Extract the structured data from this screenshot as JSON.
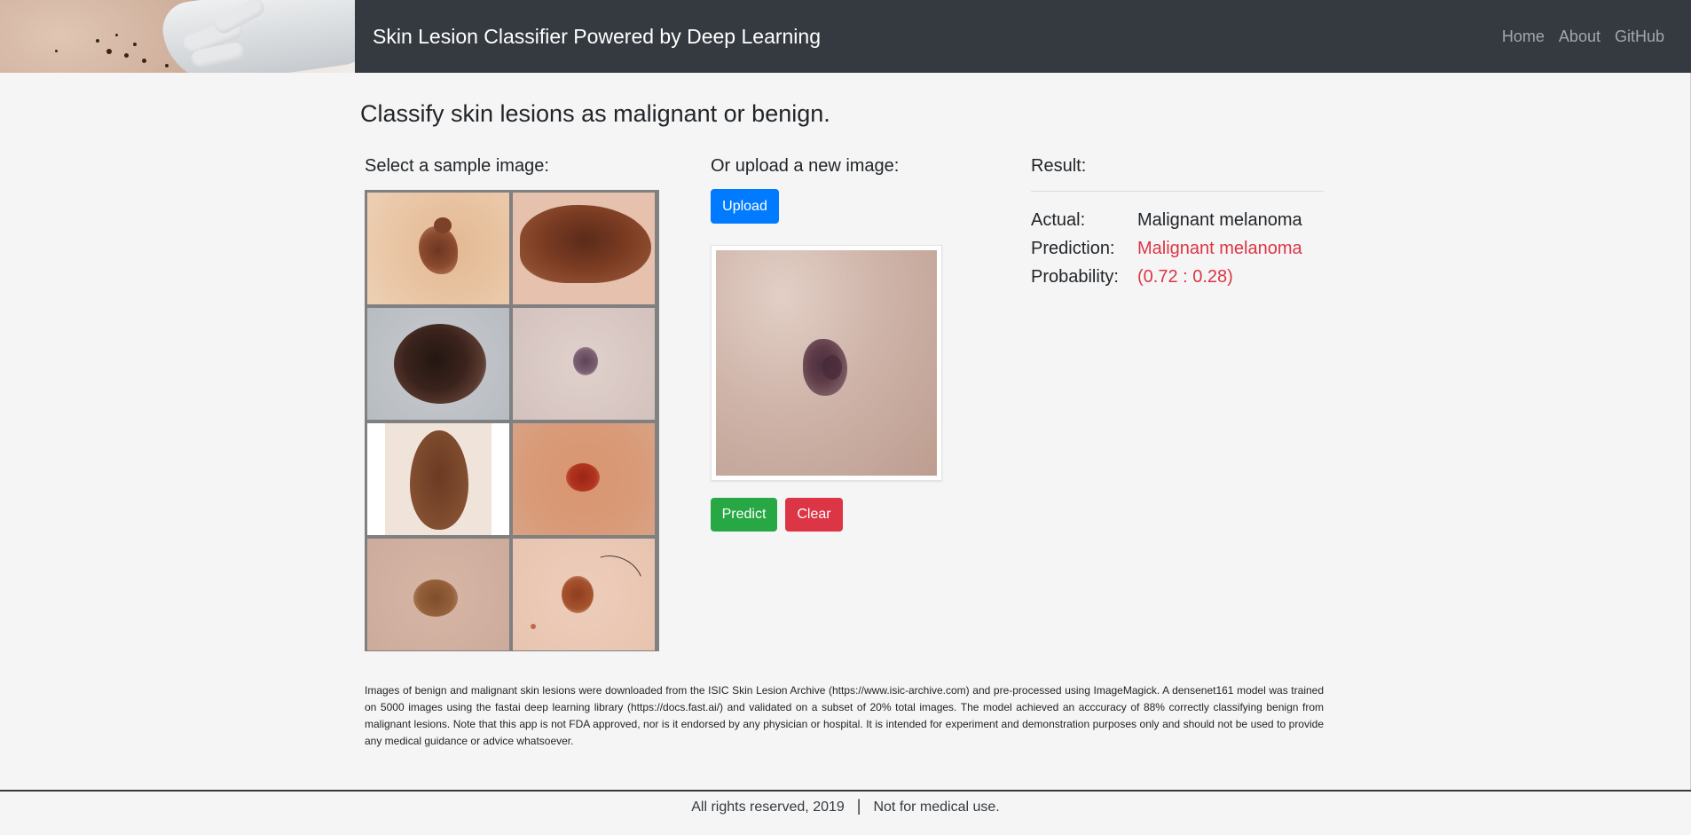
{
  "header": {
    "brand": "Skin Lesion Classifier Powered by Deep Learning",
    "nav": [
      "Home",
      "About",
      "GitHub"
    ]
  },
  "main": {
    "title": "Classify skin lesions as malignant or benign.",
    "samples_heading": "Select a sample image:",
    "upload_heading": "Or upload a new image:",
    "upload_label": "Upload",
    "predict_label": "Predict",
    "clear_label": "Clear",
    "result_heading": "Result:",
    "result": {
      "actual_label": "Actual:",
      "actual_value": "Malignant melanoma",
      "prediction_label": "Prediction:",
      "prediction_value": "Malignant melanoma",
      "probability_label": "Probability:",
      "probability_value": "(0.72 : 0.28)"
    },
    "disclaimer": "Images of benign and malignant skin lesions were downloaded from the ISIC Skin Lesion Archive (https://www.isic-archive.com) and pre-processed using ImageMagick. A densenet161 model was trained on 5000 images using the fastai deep learning library (https://docs.fast.ai/) and validated on a subset of 20% total images. The model achieved an acccuracy of 88% correctly classifying benign from malignant lesions. Note that this app is not FDA approved, nor is it endorsed by any physician or hospital. It is intended for experiment and demonstration purposes only and should not be used to provide any medical guidance or advice whatsoever."
  },
  "footer": {
    "rights": "All rights reserved, 2019",
    "separator": "|",
    "note": "Not for medical use."
  },
  "colors": {
    "navbar": "#343a40",
    "upload": "#007bff",
    "predict": "#28a745",
    "clear": "#dc3545",
    "prediction_text": "#dc3545"
  }
}
